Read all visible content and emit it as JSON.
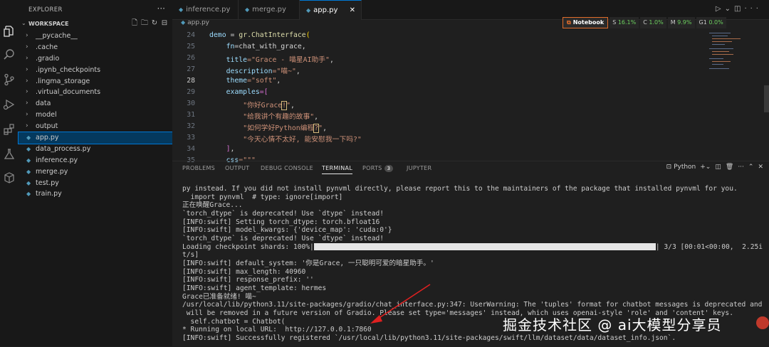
{
  "sidebar": {
    "title": "EXPLORER",
    "workspace": "WORKSPACE",
    "items": [
      {
        "label": "__pycache__",
        "kind": "folder"
      },
      {
        "label": ".cache",
        "kind": "folder"
      },
      {
        "label": ".gradio",
        "kind": "folder"
      },
      {
        "label": ".ipynb_checkpoints",
        "kind": "folder"
      },
      {
        "label": ".lingma_storage",
        "kind": "folder"
      },
      {
        "label": ".virtual_documents",
        "kind": "folder"
      },
      {
        "label": "data",
        "kind": "folder"
      },
      {
        "label": "model",
        "kind": "folder"
      },
      {
        "label": "output",
        "kind": "folder"
      },
      {
        "label": "app.py",
        "kind": "file",
        "selected": true
      },
      {
        "label": "data_process.py",
        "kind": "file"
      },
      {
        "label": "inference.py",
        "kind": "file"
      },
      {
        "label": "merge.py",
        "kind": "file"
      },
      {
        "label": "test.py",
        "kind": "file"
      },
      {
        "label": "train.py",
        "kind": "file"
      }
    ]
  },
  "tabs": [
    {
      "label": "inference.py"
    },
    {
      "label": "merge.py"
    },
    {
      "label": "app.py",
      "active": true
    }
  ],
  "breadcrumb": "app.py",
  "code": {
    "line_numbers": [
      "24",
      "25",
      "26",
      "27",
      "28",
      "29",
      "30",
      "31",
      "32",
      "33",
      "34",
      "35"
    ],
    "current_line": "28"
  },
  "status": {
    "notebook": "Notebook",
    "s_label": "S",
    "s_value": "16.1%",
    "c_label": "C",
    "c_value": "1.0%",
    "m_label": "M",
    "m_value": "9.9%",
    "g_label": "G1",
    "g_value": "0.0%"
  },
  "panel": {
    "tabs": [
      "PROBLEMS",
      "OUTPUT",
      "DEBUG CONSOLE",
      "TERMINAL",
      "PORTS",
      "JUPYTER"
    ],
    "ports_count": "3",
    "active_tab": "TERMINAL",
    "shell": "Python"
  },
  "terminal": {
    "lines": [
      "py instead. If you did not install pynvml directly, please report this to the maintainers of the package that installed pynvml for you.",
      "  import pynvml  # type: ignore[import]",
      "正在唤醒Grace...",
      "`torch_dtype` is deprecated! Use `dtype` instead!",
      "[INFO:swift] Setting torch_dtype: torch.bfloat16",
      "[INFO:swift] model_kwargs: {'device_map': 'cuda:0'}",
      "`torch_dtype` is deprecated! Use `dtype` instead!"
    ],
    "progress_prefix": "Loading checkpoint shards: 100%|",
    "progress_suffix": "| 3/3 [00:01<00:00,  2.25i",
    "progress_wrap": "t/s]",
    "progress_fraction": 1.0,
    "lines_after": [
      "[INFO:swift] default_system: '你是Grace, 一只聪明可爱的暗星助手。'",
      "[INFO:swift] max_length: 40960",
      "[INFO:swift] response_prefix: ''",
      "[INFO:swift] agent_template: hermes",
      "Grace已准备就绪! 喵~",
      "/usr/local/lib/python3.11/site-packages/gradio/chat_interface.py:347: UserWarning: The 'tuples' format for chatbot messages is deprecated and",
      " will be removed in a future version of Gradio. Please set type='messages' instead, which uses openai-style 'role' and 'content' keys.",
      "  self.chatbot = Chatbot(",
      "* Running on local URL:  http://127.0.0.1:7860",
      "[INFO:swift] Successfully registered `/usr/local/lib/python3.11/site-packages/swift/llm/dataset/data/dataset_info.json`."
    ]
  },
  "watermark": "掘金技术社区 @ ai大模型分享员"
}
